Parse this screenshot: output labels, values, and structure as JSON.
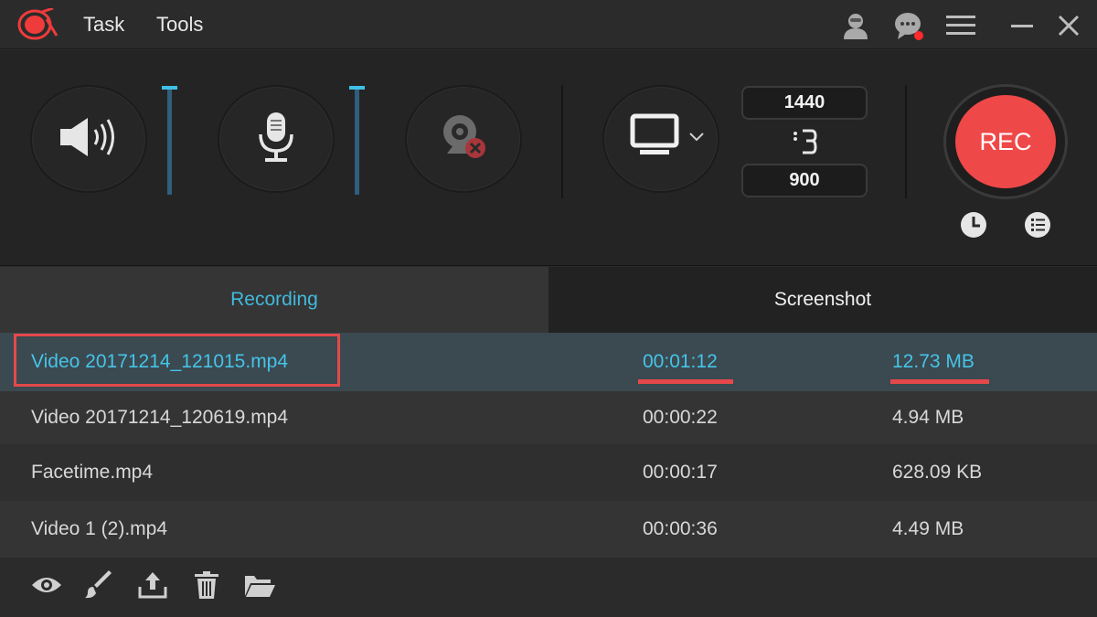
{
  "titlebar": {
    "logo_icon": "app-logo-icon",
    "menu": [
      {
        "label": "Task"
      },
      {
        "label": "Tools"
      }
    ],
    "icons": [
      "account-icon",
      "feedback-icon",
      "menu-icon",
      "minimize-icon",
      "close-icon"
    ],
    "notification_color": "#ff2a2a"
  },
  "controls": {
    "system_sound_icon": "speaker-icon",
    "microphone_icon": "microphone-icon",
    "webcam_icon": "webcam-disabled-icon",
    "screen_icon": "monitor-icon",
    "resolution": {
      "width": "1440",
      "height": "900",
      "link_icon": "chain-link-icon"
    },
    "rec_label": "REC",
    "rec_color": "#ef4848",
    "schedule_icon": "clock-icon",
    "task_list_icon": "list-icon",
    "slider_color": "#3fc0e6"
  },
  "tabs": [
    {
      "label": "Recording",
      "active": true
    },
    {
      "label": "Screenshot",
      "active": false
    }
  ],
  "files": [
    {
      "name": "Video 20171214_121015.mp4",
      "duration": "00:01:12",
      "size": "12.73 MB"
    },
    {
      "name": "Video 20171214_120619.mp4",
      "duration": "00:00:22",
      "size": "4.94 MB"
    },
    {
      "name": "Facetime.mp4",
      "duration": "00:00:17",
      "size": "628.09 KB"
    },
    {
      "name": "Video 1 (2).mp4",
      "duration": "00:00:36",
      "size": "4.49 MB"
    }
  ],
  "highlight_color": "#e5484a",
  "accent_color": "#41b9dc",
  "bottom_toolbar": [
    "preview-icon",
    "edit-icon",
    "export-icon",
    "delete-icon",
    "open-folder-icon"
  ]
}
